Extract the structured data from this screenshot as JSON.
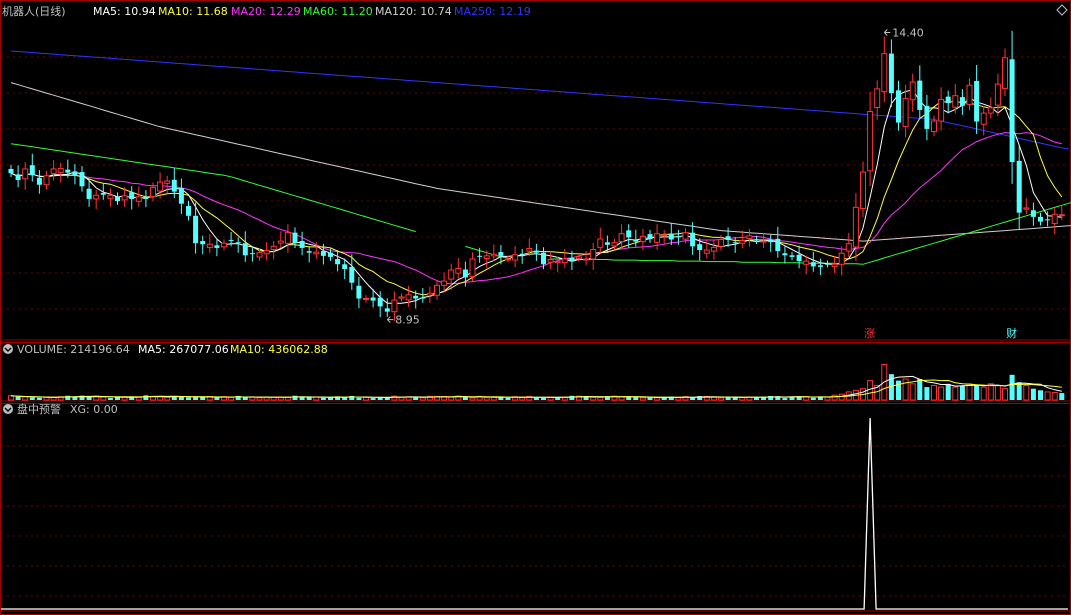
{
  "main": {
    "title": "机器人(日线)",
    "ma": [
      {
        "label": "MA5: 10.94",
        "color": "#ffffff"
      },
      {
        "label": "MA10: 11.68",
        "color": "#ffff33"
      },
      {
        "label": "MA20: 12.29",
        "color": "#ff33ff"
      },
      {
        "label": "MA60: 11.20",
        "color": "#33ff33"
      },
      {
        "label": "MA120: 10.74",
        "color": "#d0d0d0"
      },
      {
        "label": "MA250: 12.19",
        "color": "#3333ff"
      }
    ],
    "high_label": "14.40",
    "low_label": "8.95",
    "markers": [
      {
        "text": "涨",
        "idx": 121
      },
      {
        "text": "财",
        "idx": 141
      }
    ]
  },
  "volume": {
    "label": "VOLUME: 214196.64",
    "ma": [
      {
        "label": "MA5: 267077.06",
        "color": "#ffffff"
      },
      {
        "label": "MA10: 436062.88",
        "color": "#ffff33"
      }
    ]
  },
  "alert": {
    "title": "盘中预警",
    "value": "XG: 0.00"
  },
  "colors": {
    "up": "#ff3333",
    "down": "#55ffff",
    "grid": "#7a0000",
    "border": "#a00000",
    "ma5": "#ffffff",
    "ma10": "#ffff33",
    "ma20": "#ff33ff",
    "ma60": "#33ff33",
    "ma120": "#d0d0d0",
    "ma250": "#3333ff",
    "text": "#c0c0c0"
  },
  "chart_data": {
    "type": "candlestick",
    "ylim": [
      8.6,
      14.6
    ],
    "closes": [
      11.73,
      11.6,
      11.81,
      11.69,
      11.51,
      11.68,
      11.81,
      11.82,
      11.74,
      11.68,
      11.48,
      11.24,
      11.31,
      11.32,
      11.31,
      11.2,
      11.3,
      11.24,
      11.28,
      11.24,
      11.46,
      11.56,
      11.58,
      11.38,
      11.15,
      10.92,
      10.4,
      10.38,
      10.38,
      10.31,
      10.4,
      10.46,
      10.4,
      10.17,
      10.2,
      10.22,
      10.26,
      10.34,
      10.44,
      10.6,
      10.4,
      10.31,
      10.22,
      10.23,
      10.16,
      10.14,
      10.0,
      9.91,
      9.65,
      9.35,
      9.35,
      9.31,
      9.2,
      9.1,
      9.32,
      9.38,
      9.42,
      9.35,
      9.36,
      9.45,
      9.6,
      9.68,
      9.89,
      9.92,
      9.75,
      10.1,
      10.15,
      10.16,
      10.19,
      10.16,
      10.1,
      10.18,
      10.19,
      10.3,
      10.22,
      10.0,
      10.09,
      10.05,
      10.1,
      10.05,
      10.14,
      10.1,
      10.28,
      10.48,
      10.37,
      10.41,
      10.58,
      10.51,
      10.43,
      10.53,
      10.48,
      10.58,
      10.56,
      10.47,
      10.52,
      10.6,
      10.34,
      10.27,
      10.27,
      10.32,
      10.47,
      10.46,
      10.4,
      10.45,
      10.54,
      10.45,
      10.44,
      10.42,
      10.25,
      10.17,
      10.14,
      10.06,
      10.06,
      9.96,
      9.95,
      10.0,
      10.0,
      10.21,
      10.39,
      11.08,
      11.75,
      12.9,
      13.33,
      14.0,
      13.25,
      12.69,
      13.15,
      13.46,
      12.93,
      12.57,
      12.72,
      13.13,
      13.06,
      13.2,
      13.01,
      13.4,
      12.71,
      12.87,
      12.97,
      13.42,
      13.92,
      11.94,
      10.98,
      11.07,
      10.9,
      10.81,
      10.84,
      10.95,
      10.94
    ],
    "volume_ylim": [
      0,
      1300000
    ],
    "volumes": [
      130360,
      102330,
      94637,
      76689,
      68342,
      86303,
      80453,
      98758,
      131474,
      95512,
      135062,
      92856,
      120587,
      90616,
      63582,
      78301,
      85318,
      106154,
      95683,
      143359,
      115620,
      111154,
      84286,
      111201,
      114398,
      78452,
      85223,
      95136,
      98484,
      71294,
      102099,
      80849,
      127119,
      80452,
      89733,
      68618,
      80226,
      92709,
      93826,
      78734,
      132239,
      91599,
      79244,
      90165,
      70000,
      75664,
      113436,
      77219,
      124926,
      69402,
      79998,
      60000,
      73356,
      89373,
      119627,
      91012,
      98713,
      88542,
      66524,
      114549,
      112212,
      106225,
      87458,
      124108,
      98587,
      63708,
      114007,
      75806,
      87306,
      86913,
      66910,
      100006,
      69710,
      112123,
      71389,
      66646,
      89807,
      87637,
      90405,
      128751,
      118963,
      108932,
      82659,
      80316,
      116302,
      121617,
      101011,
      90542,
      87224,
      67542,
      74014,
      68016,
      77694,
      104640,
      70637,
      105398,
      73300,
      120225,
      111200,
      88225,
      63722,
      85591,
      91998,
      80213,
      90848,
      77938,
      83066,
      124683,
      116394,
      60000,
      107224,
      112165,
      102013,
      68244,
      95316,
      85000,
      150000,
      180000,
      250000,
      300000,
      350000,
      600000,
      450000,
      1100000,
      800000,
      600000,
      650000,
      500000,
      650000,
      400000,
      450000,
      400000,
      500000,
      400000,
      450000,
      500000,
      450000,
      400000,
      500000,
      450000,
      350000,
      780000,
      550000,
      450000,
      350000,
      300000,
      250000,
      230000,
      214196
    ],
    "ma5": [
      11.73,
      11.67,
      11.71,
      11.71,
      11.67,
      11.66,
      11.7,
      11.7,
      11.71,
      11.75,
      11.71,
      11.59,
      11.45,
      11.37,
      11.33,
      11.28,
      11.29,
      11.27,
      11.27,
      11.25,
      11.3,
      11.36,
      11.42,
      11.44,
      11.43,
      11.32,
      11.09,
      10.85,
      10.65,
      10.48,
      10.37,
      10.39,
      10.39,
      10.35,
      10.33,
      10.29,
      10.24,
      10.24,
      10.29,
      10.37,
      10.41,
      10.42,
      10.38,
      10.35,
      10.26,
      10.21,
      10.15,
      10.09,
      9.97,
      9.81,
      9.65,
      9.51,
      9.37,
      9.26,
      9.26,
      9.26,
      9.28,
      9.31,
      9.37,
      9.39,
      9.44,
      9.49,
      9.6,
      9.71,
      9.77,
      9.87,
      9.96,
      10.02,
      10.07,
      10.15,
      10.15,
      10.16,
      10.16,
      10.19,
      10.2,
      10.18,
      10.16,
      10.13,
      10.09,
      10.06,
      10.09,
      10.09,
      10.12,
      10.21,
      10.27,
      10.33,
      10.42,
      10.47,
      10.46,
      10.49,
      10.5,
      10.51,
      10.52,
      10.52,
      10.52,
      10.55,
      10.5,
      10.44,
      10.4,
      10.36,
      10.33,
      10.36,
      10.38,
      10.42,
      10.46,
      10.46,
      10.46,
      10.46,
      10.42,
      10.35,
      10.28,
      10.21,
      10.14,
      10.08,
      10.03,
      10.01,
      9.99,
      10.02,
      10.11,
      10.33,
      10.69,
      11.27,
      11.89,
      12.61,
      13.05,
      13.22,
      13.28,
      13.31,
      13.1,
      12.96,
      12.97,
      12.95,
      12.88,
      12.94,
      13.02,
      13.16,
      13.08,
      13.04,
      12.99,
      12.87,
      12.98,
      12.63,
      12.26,
      11.88,
      11.36,
      11.14,
      10.92,
      10.91,
      10.89
    ],
    "ma10": [
      11.73,
      11.67,
      11.71,
      11.71,
      11.67,
      11.66,
      11.68,
      11.69,
      11.69,
      11.69,
      11.66,
      11.62,
      11.57,
      11.54,
      11.52,
      11.47,
      11.42,
      11.37,
      11.32,
      11.28,
      11.28,
      11.31,
      11.34,
      11.35,
      11.34,
      11.31,
      11.2,
      11.06,
      10.97,
      10.88,
      10.77,
      10.66,
      10.54,
      10.42,
      10.33,
      10.26,
      10.24,
      10.24,
      10.3,
      10.37,
      10.37,
      10.35,
      10.33,
      10.33,
      10.33,
      10.31,
      10.25,
      10.2,
      10.13,
      10.0,
      9.92,
      9.86,
      9.76,
      9.67,
      9.63,
      9.56,
      9.5,
      9.45,
      9.42,
      9.43,
      9.45,
      9.48,
      9.55,
      9.63,
      9.67,
      9.75,
      9.83,
      9.9,
      9.98,
      10.05,
      10.1,
      10.15,
      10.18,
      10.22,
      10.25,
      10.24,
      10.24,
      10.23,
      10.22,
      10.2,
      10.2,
      10.19,
      10.2,
      10.22,
      10.23,
      10.27,
      10.32,
      10.37,
      10.41,
      10.45,
      10.49,
      10.54,
      10.57,
      10.57,
      10.58,
      10.6,
      10.58,
      10.55,
      10.53,
      10.51,
      10.51,
      10.48,
      10.45,
      10.45,
      10.45,
      10.43,
      10.44,
      10.45,
      10.42,
      10.4,
      10.37,
      10.33,
      10.3,
      10.27,
      10.23,
      10.18,
      10.14,
      10.11,
      10.1,
      10.15,
      10.24,
      10.53,
      10.86,
      11.28,
      11.61,
      11.96,
      12.26,
      12.55,
      12.77,
      12.86,
      12.99,
      13.09,
      13.08,
      13.09,
      13.07,
      13.06,
      13.03,
      12.99,
      12.96,
      12.98,
      12.99,
      12.9,
      12.78,
      12.62,
      12.46,
      12.03,
      11.68,
      11.46,
      11.28
    ],
    "ma20": [
      11.73,
      11.67,
      11.71,
      11.71,
      11.67,
      11.66,
      11.68,
      11.69,
      11.69,
      11.69,
      11.67,
      11.65,
      11.63,
      11.62,
      11.6,
      11.58,
      11.57,
      11.54,
      11.53,
      11.5,
      11.49,
      11.49,
      11.48,
      11.47,
      11.45,
      11.42,
      11.37,
      11.3,
      11.24,
      11.18,
      11.13,
      11.08,
      11.03,
      10.97,
      10.9,
      10.84,
      10.77,
      10.71,
      10.66,
      10.62,
      10.57,
      10.51,
      10.44,
      10.37,
      10.31,
      10.26,
      10.24,
      10.23,
      10.22,
      10.21,
      10.17,
      10.14,
      10.11,
      10.08,
      10.05,
      10.0,
      9.94,
      9.89,
      9.82,
      9.75,
      9.69,
      9.64,
      9.63,
      9.64,
      9.66,
      9.67,
      9.69,
      9.7,
      9.72,
      9.74,
      9.76,
      9.8,
      9.84,
      9.89,
      9.93,
      9.97,
      10.03,
      10.07,
      10.11,
      10.12,
      10.16,
      10.19,
      10.21,
      10.23,
      10.24,
      10.27,
      10.29,
      10.31,
      10.32,
      10.33,
      10.34,
      10.36,
      10.38,
      10.41,
      10.42,
      10.45,
      10.46,
      10.46,
      10.46,
      10.46,
      10.47,
      10.49,
      10.5,
      10.51,
      10.52,
      10.53,
      10.51,
      10.48,
      10.45,
      10.44,
      10.42,
      10.4,
      10.38,
      10.36,
      10.34,
      10.32,
      10.31,
      10.29,
      10.28,
      10.3,
      10.32,
      10.42,
      10.57,
      10.78,
      10.94,
      11.05,
      11.17,
      11.32,
      11.45,
      11.56,
      11.67,
      11.78,
      11.92,
      12.05,
      12.18,
      12.25,
      12.33,
      12.38,
      12.43,
      12.47,
      12.5,
      12.49,
      12.48,
      12.5,
      12.48,
      12.44,
      12.38,
      12.32,
      12.29
    ],
    "ma60": [
      12.29,
      12.27,
      12.25,
      12.23,
      12.21,
      12.19,
      12.17,
      12.15,
      12.13,
      12.11,
      12.09,
      12.07,
      12.05,
      12.03,
      12.01,
      11.99,
      11.97,
      11.95,
      11.93,
      11.91,
      11.89,
      11.87,
      11.85,
      11.83,
      11.81,
      11.79,
      11.77,
      11.75,
      11.73,
      11.71,
      11.69,
      11.66,
      11.62,
      11.58,
      11.54,
      11.5,
      11.46,
      11.42,
      11.38,
      11.34,
      11.3,
      11.26,
      11.22,
      11.18,
      11.14,
      11.1,
      11.06,
      11.02,
      10.98,
      10.94,
      10.9,
      10.86,
      10.82,
      10.78,
      10.74,
      10.7,
      10.66,
      10.62,
      10.58,
      10.54,
      10.5,
      10.46,
      10.42,
      10.38,
      10.34,
      10.3,
      10.26,
      10.22,
      10.18,
      10.14,
      10.12,
      10.12,
      10.11,
      10.11,
      10.11,
      10.11,
      10.1,
      10.1,
      10.1,
      10.1,
      10.09,
      10.09,
      10.09,
      10.09,
      10.09,
      10.08,
      10.08,
      10.08,
      10.08,
      10.07,
      10.07,
      10.07,
      10.07,
      10.07,
      10.06,
      10.06,
      10.06,
      10.06,
      10.05,
      10.05,
      10.05,
      10.05,
      10.05,
      10.04,
      10.04,
      10.04,
      10.04,
      10.04,
      10.03,
      10.03,
      10.03,
      10.03,
      10.02,
      10.02,
      10.02,
      10.02,
      10.02,
      10.01,
      10.01,
      10.01,
      10.0,
      10.04,
      10.08,
      10.12,
      10.16,
      10.2,
      10.24,
      10.28,
      10.32,
      10.36,
      10.4,
      10.44,
      10.48,
      10.52,
      10.56,
      10.6,
      10.64,
      10.68,
      10.72,
      10.76,
      10.8,
      10.84,
      10.88,
      10.92,
      10.96,
      11.0,
      11.04,
      11.08,
      11.12,
      11.16,
      11.2
    ],
    "ma60_segments": [
      [
        0,
        57
      ],
      [
        64,
        70
      ],
      [
        76,
        150
      ]
    ],
    "ma120": [
      13.45,
      13.41,
      13.37,
      13.33,
      13.29,
      13.25,
      13.21,
      13.17,
      13.13,
      13.09,
      13.05,
      13.01,
      12.97,
      12.93,
      12.89,
      12.85,
      12.81,
      12.77,
      12.73,
      12.69,
      12.65,
      12.61,
      12.58,
      12.55,
      12.52,
      12.49,
      12.46,
      12.43,
      12.4,
      12.37,
      12.34,
      12.31,
      12.28,
      12.25,
      12.22,
      12.19,
      12.16,
      12.13,
      12.1,
      12.07,
      12.04,
      12.01,
      11.98,
      11.95,
      11.92,
      11.89,
      11.86,
      11.83,
      11.8,
      11.77,
      11.74,
      11.71,
      11.68,
      11.65,
      11.62,
      11.59,
      11.56,
      11.53,
      11.5,
      11.47,
      11.44,
      11.42,
      11.4,
      11.38,
      11.36,
      11.34,
      11.32,
      11.3,
      11.28,
      11.26,
      11.24,
      11.22,
      11.2,
      11.18,
      11.16,
      11.14,
      11.12,
      11.1,
      11.08,
      11.06,
      11.04,
      11.02,
      11.0,
      10.98,
      10.96,
      10.94,
      10.92,
      10.9,
      10.88,
      10.86,
      10.84,
      10.82,
      10.8,
      10.78,
      10.76,
      10.74,
      10.72,
      10.7,
      10.68,
      10.66,
      10.64,
      10.63,
      10.62,
      10.61,
      10.6,
      10.59,
      10.58,
      10.57,
      10.56,
      10.55,
      10.54,
      10.53,
      10.52,
      10.51,
      10.5,
      10.49,
      10.48,
      10.47,
      10.46,
      10.45,
      10.44,
      10.45,
      10.46,
      10.47,
      10.48,
      10.49,
      10.5,
      10.51,
      10.52,
      10.53,
      10.54,
      10.55,
      10.56,
      10.57,
      10.58,
      10.59,
      10.6,
      10.61,
      10.62,
      10.63,
      10.64,
      10.65,
      10.66,
      10.67,
      10.68,
      10.69,
      10.7,
      10.71,
      10.72,
      10.73,
      10.74
    ],
    "ma250": [
      14.05,
      14.04,
      14.03,
      14.02,
      14.01,
      14.0,
      13.99,
      13.98,
      13.97,
      13.96,
      13.95,
      13.94,
      13.93,
      13.92,
      13.91,
      13.9,
      13.89,
      13.88,
      13.87,
      13.86,
      13.85,
      13.84,
      13.83,
      13.82,
      13.81,
      13.8,
      13.79,
      13.78,
      13.77,
      13.76,
      13.75,
      13.74,
      13.73,
      13.72,
      13.71,
      13.7,
      13.69,
      13.68,
      13.67,
      13.66,
      13.65,
      13.64,
      13.63,
      13.62,
      13.61,
      13.6,
      13.59,
      13.58,
      13.57,
      13.56,
      13.55,
      13.54,
      13.53,
      13.52,
      13.51,
      13.5,
      13.49,
      13.48,
      13.47,
      13.46,
      13.45,
      13.44,
      13.43,
      13.42,
      13.41,
      13.4,
      13.39,
      13.38,
      13.37,
      13.36,
      13.35,
      13.34,
      13.33,
      13.32,
      13.31,
      13.3,
      13.29,
      13.28,
      13.27,
      13.26,
      13.25,
      13.24,
      13.23,
      13.22,
      13.21,
      13.2,
      13.19,
      13.18,
      13.17,
      13.16,
      13.15,
      13.14,
      13.13,
      13.12,
      13.11,
      13.1,
      13.09,
      13.08,
      13.07,
      13.06,
      13.05,
      13.04,
      13.03,
      13.02,
      13.01,
      13.0,
      12.99,
      12.98,
      12.97,
      12.96,
      12.95,
      12.94,
      12.93,
      12.92,
      12.91,
      12.9,
      12.89,
      12.88,
      12.87,
      12.86,
      12.85,
      12.84,
      12.83,
      12.82,
      12.81,
      12.8,
      12.79,
      12.78,
      12.77,
      12.76,
      12.75,
      12.72,
      12.69,
      12.66,
      12.63,
      12.6,
      12.57,
      12.54,
      12.51,
      12.48,
      12.45,
      12.42,
      12.39,
      12.36,
      12.33,
      12.3,
      12.27,
      12.24,
      12.21,
      12.19
    ],
    "xg_ylim": [
      0,
      1
    ],
    "xg_spike_index": 121
  }
}
